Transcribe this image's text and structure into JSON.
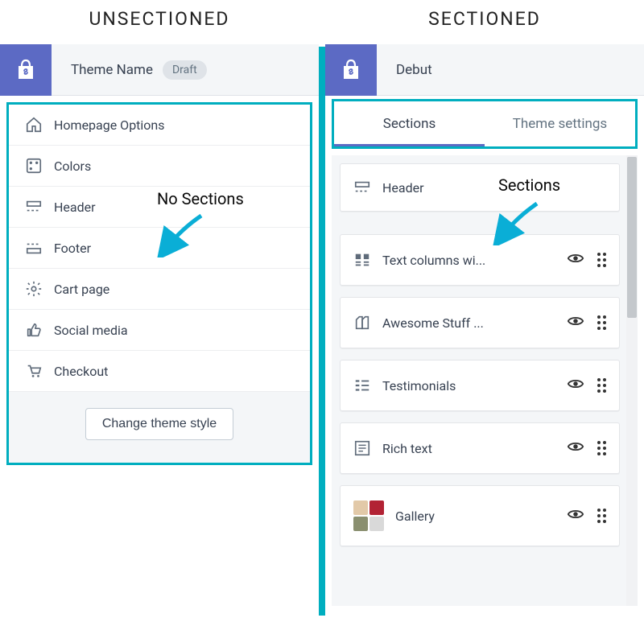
{
  "headings": {
    "left": "UNSECTIONED",
    "right": "SECTIONED"
  },
  "annotations": {
    "left": "No Sections",
    "right": "Sections"
  },
  "left": {
    "theme_name": "Theme Name",
    "badge": "Draft",
    "menu": [
      {
        "label": "Homepage Options"
      },
      {
        "label": "Colors"
      },
      {
        "label": "Header"
      },
      {
        "label": "Footer"
      },
      {
        "label": "Cart page"
      },
      {
        "label": "Social media"
      },
      {
        "label": "Checkout"
      }
    ],
    "change_button": "Change theme style"
  },
  "right": {
    "theme_name": "Debut",
    "tabs": {
      "sections": "Sections",
      "theme_settings": "Theme settings"
    },
    "items": [
      {
        "label": "Header"
      },
      {
        "label": "Text columns wi..."
      },
      {
        "label": "Awesome Stuff ..."
      },
      {
        "label": "Testimonials"
      },
      {
        "label": "Rich text"
      },
      {
        "label": "Gallery"
      }
    ]
  },
  "colors": {
    "brand": "#5c6ac4",
    "highlight": "#00aebf"
  }
}
